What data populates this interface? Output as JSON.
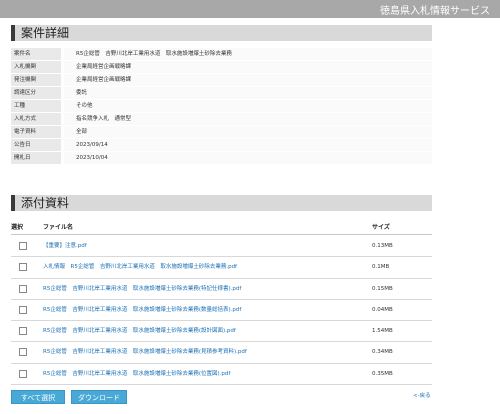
{
  "header": {
    "site_title": "徳島県入札情報サービス"
  },
  "details_section": {
    "title": "案件詳細",
    "rows": [
      {
        "label": "案件名",
        "value": "R5企総管　吉野川北岸工業用水道　取水施設増爆土砂除去業務"
      },
      {
        "label": "入札機関",
        "value": "企業局経営企画戦略課"
      },
      {
        "label": "発注機関",
        "value": "企業局経営企画戦略課"
      },
      {
        "label": "調達区分",
        "value": "委託"
      },
      {
        "label": "工種",
        "value": "その他"
      },
      {
        "label": "入札方式",
        "value": "指名競争入札　通常型"
      },
      {
        "label": "電子資料",
        "value": "全部"
      },
      {
        "label": "公告日",
        "value": "2023/09/14"
      },
      {
        "label": "開札日",
        "value": "2023/10/04"
      }
    ]
  },
  "attachments_section": {
    "title": "添付資料",
    "columns": {
      "select": "選択",
      "filename": "ファイル名",
      "size": "サイズ"
    },
    "files": [
      {
        "name": "【重要】注意.pdf",
        "size": "0.13MB"
      },
      {
        "name": "入札情報　R5企総管　吉野川北岸工業用水道　取水施設増爆土砂除去業務.pdf",
        "size": "0.1MB"
      },
      {
        "name": "R5企総管　吉野川北岸工業用水道　取水施設増爆土砂除去業務(特記仕様書).pdf",
        "size": "0.15MB"
      },
      {
        "name": "R5企総管　吉野川北岸工業用水道　取水施設増爆土砂除去業務(数量総括表).pdf",
        "size": "0.04MB"
      },
      {
        "name": "R5企総管　吉野川北岸工業用水道　取水施設増爆土砂除去業務(設計図面).pdf",
        "size": "1.54MB"
      },
      {
        "name": "R5企総管　吉野川北岸工業用水道　取水施設増爆土砂除去業務(見積参考資料).pdf",
        "size": "0.34MB"
      },
      {
        "name": "R5企総管　吉野川北岸工業用水道　取水施設増爆土砂除去業務(位置図).pdf",
        "size": "0.35MB"
      }
    ]
  },
  "actions": {
    "select_all_label": "すべて選択",
    "download_label": "ダウンロード",
    "back_label": "<-戻る"
  },
  "colors": {
    "header_bg": "#a8a8a8",
    "button_bg": "#49a9d6",
    "link": "#1a6fb5"
  }
}
